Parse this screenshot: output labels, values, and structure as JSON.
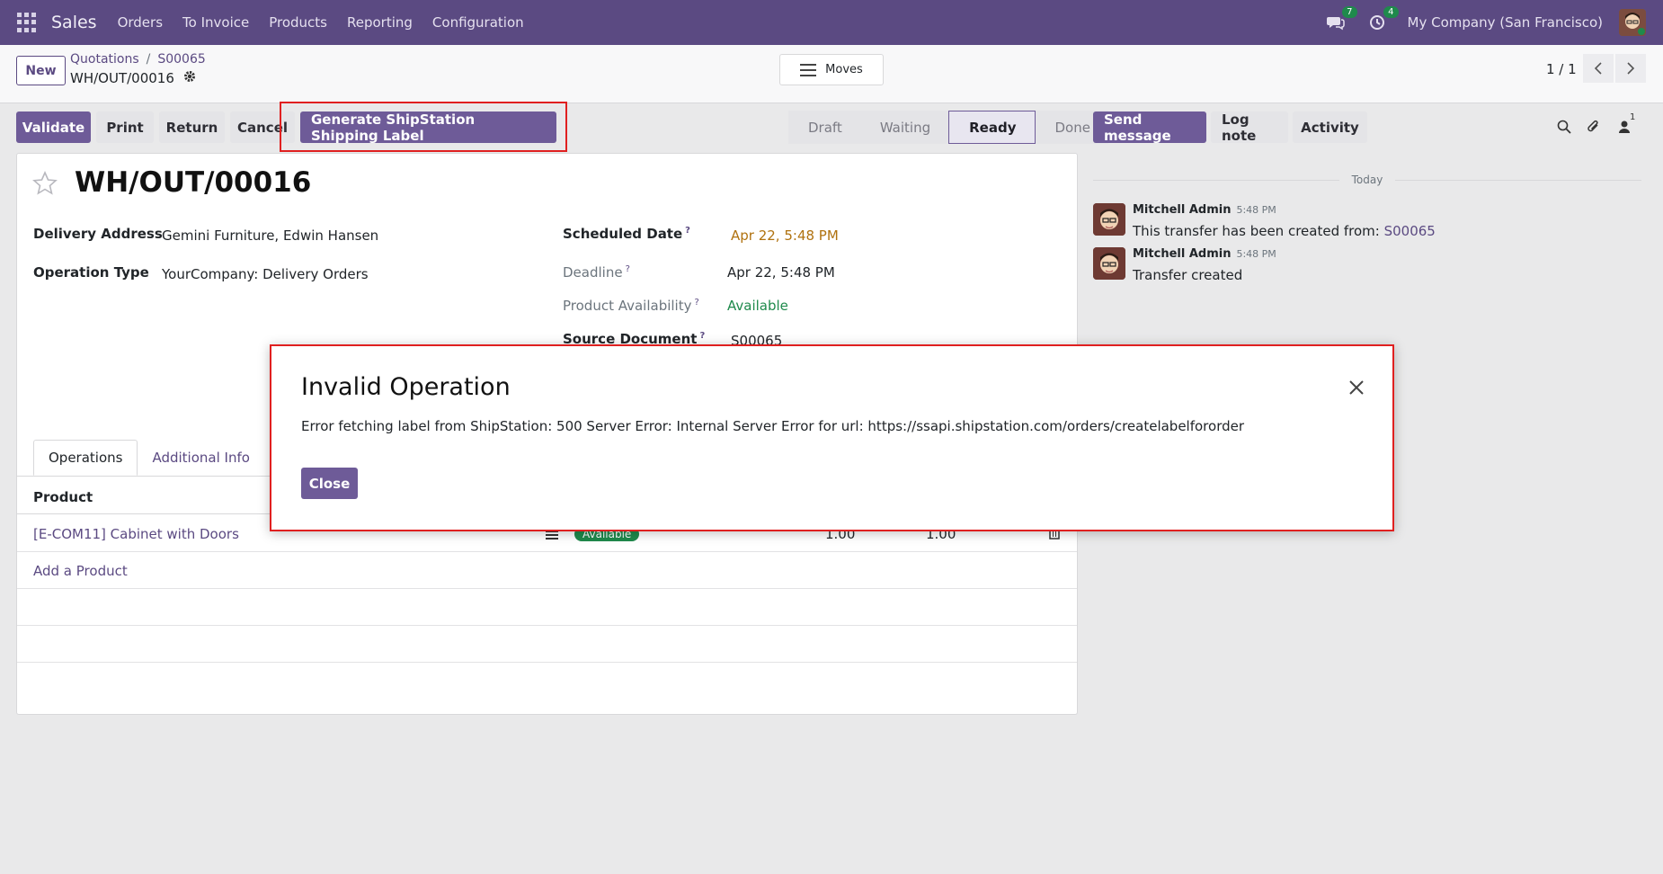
{
  "navbar": {
    "app_name": "Sales",
    "menu": [
      "Orders",
      "To Invoice",
      "Products",
      "Reporting",
      "Configuration"
    ],
    "messages_count": "7",
    "activities_count": "4",
    "company": "My Company (San Francisco)"
  },
  "control_panel": {
    "new_label": "New",
    "breadcrumb_root": "Quotations",
    "breadcrumb_sep": "/",
    "breadcrumb_order": "S00065",
    "record_name": "WH/OUT/00016",
    "moves_label": "Moves",
    "pager": "1 / 1"
  },
  "actions": {
    "validate": "Validate",
    "print": "Print",
    "return": "Return",
    "cancel": "Cancel",
    "shipstation": "Generate ShipStation Shipping Label"
  },
  "status_stages": [
    "Draft",
    "Waiting",
    "Ready",
    "Done"
  ],
  "status_active": "Ready",
  "form": {
    "title": "WH/OUT/00016",
    "delivery_address_label": "Delivery Address",
    "delivery_address": "Gemini Furniture, Edwin Hansen",
    "operation_type_label": "Operation Type",
    "operation_type": "YourCompany: Delivery Orders",
    "scheduled_date_label": "Scheduled Date",
    "scheduled_date": "Apr 22, 5:48 PM",
    "deadline_label": "Deadline",
    "deadline": "Apr 22, 5:48 PM",
    "availability_label": "Product Availability",
    "availability": "Available",
    "source_doc_label": "Source Document",
    "source_doc": "S00065",
    "help_mark": "?"
  },
  "tabs": [
    "Operations",
    "Additional Info"
  ],
  "operations": {
    "header_product": "Product",
    "rows": [
      {
        "product": "[E-COM11] Cabinet with Doors",
        "status": "Available",
        "demand": "1.00",
        "quantity": "1.00"
      }
    ],
    "add_label": "Add a Product"
  },
  "chatter": {
    "send_message": "Send message",
    "log_note": "Log note",
    "activity": "Activity",
    "followers_count": "1",
    "today_label": "Today",
    "messages": [
      {
        "author": "Mitchell Admin",
        "time": "5:48 PM",
        "body": "This transfer has been created from:",
        "link": "S00065"
      },
      {
        "author": "Mitchell Admin",
        "time": "5:48 PM",
        "body": "Transfer created",
        "link": ""
      }
    ]
  },
  "modal": {
    "title": "Invalid Operation",
    "message": "Error fetching label from ShipStation: 500 Server Error: Internal Server Error for url: https://ssapi.shipstation.com/orders/createlabelfororder",
    "close_label": "Close"
  },
  "colors": {
    "brand": "#5b4a82",
    "primary_button": "#6e5b98",
    "highlight_frame": "#e02020",
    "success": "#1f8a4c",
    "warning": "#b0720f"
  }
}
